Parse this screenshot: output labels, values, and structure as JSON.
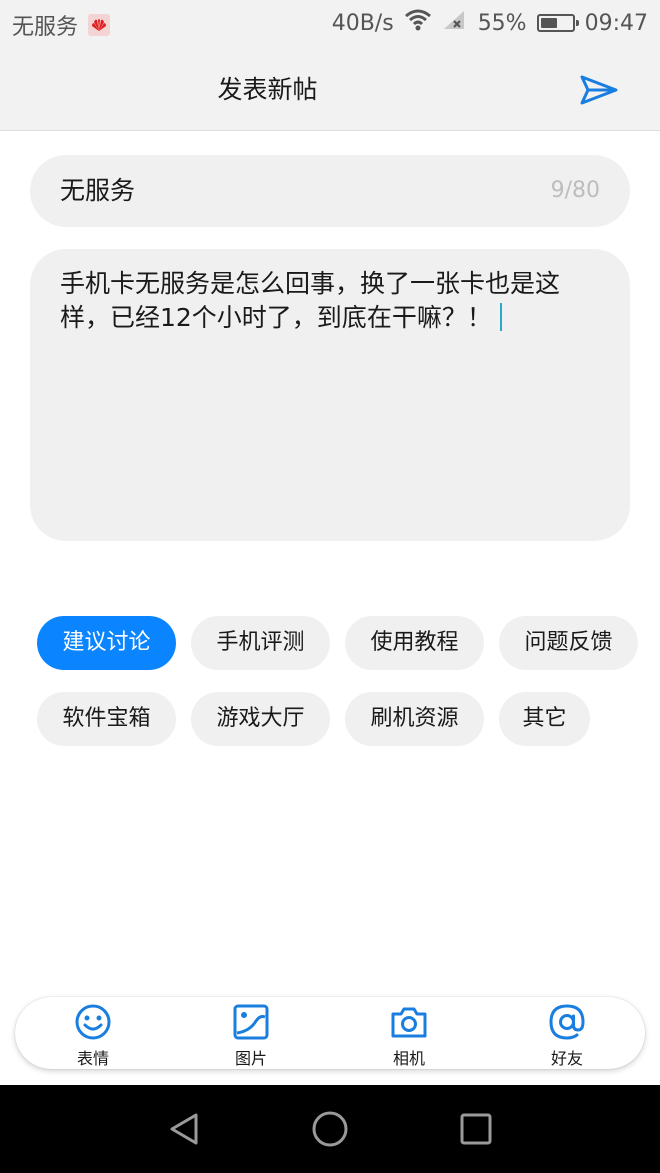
{
  "status_bar": {
    "carrier": "无服务",
    "speed": "40B/s",
    "battery": "55%",
    "time": "09:47",
    "battery_level": 0.55
  },
  "header": {
    "title": "发表新帖",
    "send_icon": "send-icon"
  },
  "post": {
    "title_value": "无服务",
    "title_counter": "9/80",
    "content_value": "手机卡无服务是怎么回事，换了一张卡也是这样，已经12个小时了，到底在干嘛？！"
  },
  "categories": [
    {
      "label": "建议讨论",
      "selected": true
    },
    {
      "label": "手机评测",
      "selected": false
    },
    {
      "label": "使用教程",
      "selected": false
    },
    {
      "label": "问题反馈",
      "selected": false
    },
    {
      "label": "软件宝箱",
      "selected": false
    },
    {
      "label": "游戏大厅",
      "selected": false
    },
    {
      "label": "刷机资源",
      "selected": false
    },
    {
      "label": "其它",
      "selected": false
    }
  ],
  "toolbar": {
    "emoji": "表情",
    "image": "图片",
    "camera": "相机",
    "friend": "好友"
  },
  "colors": {
    "accent": "#0a84ff",
    "input_bg": "#f0f0f0",
    "header_bg": "#f2f2f2"
  }
}
